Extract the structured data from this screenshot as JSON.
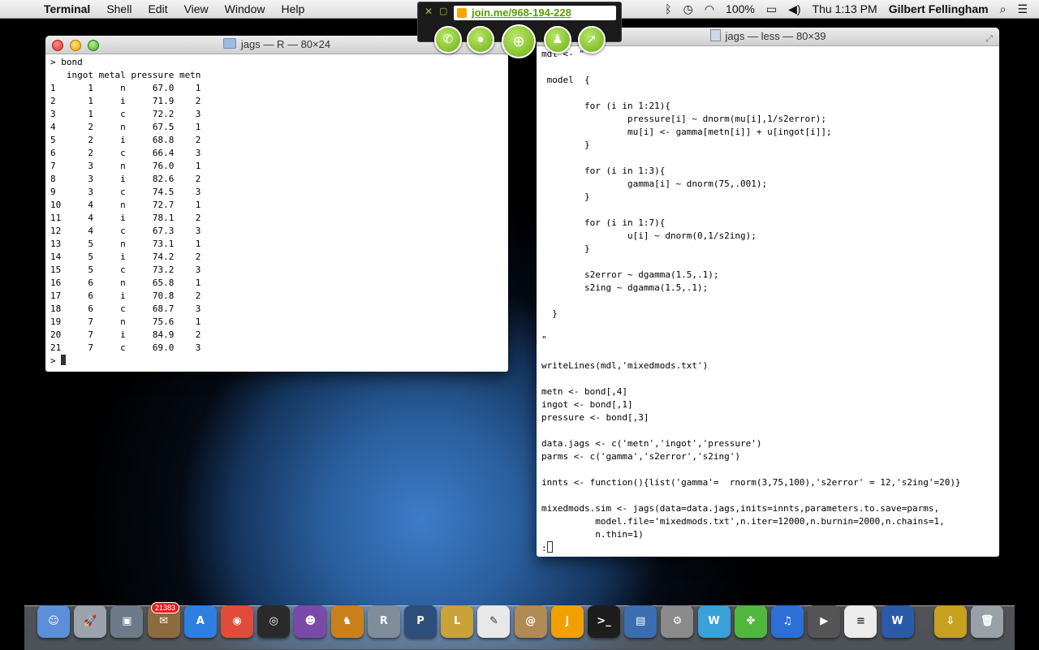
{
  "menubar": {
    "app_name": "Terminal",
    "items": [
      "Shell",
      "Edit",
      "View",
      "Window",
      "Help"
    ],
    "battery": "100%",
    "clock": "Thu 1:13 PM",
    "user": "Gilbert Fellingham"
  },
  "joinme": {
    "url": "join.me/968-194-228"
  },
  "r_window": {
    "title": "jags — R — 80×24",
    "lines": [
      "> bond",
      "   ingot metal pressure metn",
      "1      1     n     67.0    1",
      "2      1     i     71.9    2",
      "3      1     c     72.2    3",
      "4      2     n     67.5    1",
      "5      2     i     68.8    2",
      "6      2     c     66.4    3",
      "7      3     n     76.0    1",
      "8      3     i     82.6    2",
      "9      3     c     74.5    3",
      "10     4     n     72.7    1",
      "11     4     i     78.1    2",
      "12     4     c     67.3    3",
      "13     5     n     73.1    1",
      "14     5     i     74.2    2",
      "15     5     c     73.2    3",
      "16     6     n     65.8    1",
      "17     6     i     70.8    2",
      "18     6     c     68.7    3",
      "19     7     n     75.6    1",
      "20     7     i     84.9    2",
      "21     7     c     69.0    3"
    ],
    "prompt": "> "
  },
  "less_window": {
    "title": "jags — less — 80×39",
    "lines": [
      "mdl <- \"",
      "",
      " model  {",
      "",
      "        for (i in 1:21){",
      "                pressure[i] ~ dnorm(mu[i],1/s2error);",
      "                mu[i] <- gamma[metn[i]] + u[ingot[i]];",
      "        }",
      "",
      "        for (i in 1:3){",
      "                gamma[i] ~ dnorm(75,.001);",
      "        }",
      "",
      "        for (i in 1:7){",
      "                u[i] ~ dnorm(0,1/s2ing);",
      "        }",
      "",
      "        s2error ~ dgamma(1.5,.1);",
      "        s2ing ~ dgamma(1.5,.1);",
      "",
      "  }",
      "",
      "\"",
      "",
      "writeLines(mdl,'mixedmods.txt')",
      "",
      "metn <- bond[,4]",
      "ingot <- bond[,1]",
      "pressure <- bond[,3]",
      "",
      "data.jags <- c('metn','ingot','pressure')",
      "parms <- c('gamma','s2error','s2ing')",
      "",
      "innts <- function(){list('gamma'=  rnorm(3,75,100),'s2error' = 12,'s2ing'=20)}",
      "",
      "mixedmods.sim <- jags(data=data.jags,inits=innts,parameters.to.save=parms,",
      "          model.file='mixedmods.txt',n.iter=12000,n.burnin=2000,n.chains=1,",
      "          n.thin=1)"
    ],
    "prompt": ":"
  },
  "dock": {
    "mail_badge": "21383",
    "items": [
      "finder",
      "launchpad",
      "preview",
      "mail",
      "app-store",
      "chrome",
      "dashboard",
      "photo-booth",
      "fetch",
      "r",
      "pandora",
      "latex",
      "textedit",
      "contacts",
      "join-me",
      "terminal",
      "virtualbox",
      "system-preferences",
      "word-wrap",
      "tweetdeck",
      "itunes",
      "facetime",
      "plist",
      "word",
      "downloads",
      "trash"
    ]
  }
}
